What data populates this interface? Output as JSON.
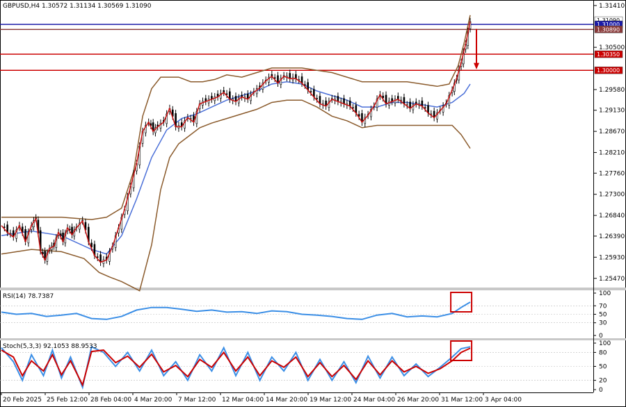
{
  "chart_data": [
    {
      "type": "candlestick",
      "title": "GBPUSD,H4  1.30572 1.31134 1.30569 1.31090",
      "ylim": [
        1.253,
        1.315
      ],
      "y_ticks": [
        "1.31410",
        "1.30500",
        "1.29580",
        "1.29130",
        "1.28670",
        "1.28210",
        "1.27760",
        "1.27300",
        "1.26840",
        "1.26390",
        "1.25930",
        "1.25470"
      ],
      "x_ticks": [
        "20 Feb 2025",
        "25 Feb 12:00",
        "28 Feb 04:00",
        "4 Mar 20:00",
        "7 Mar 12:00",
        "12 Mar 04:00",
        "14 Mar 20:00",
        "19 Mar 12:00",
        "24 Mar 04:00",
        "26 Mar 20:00",
        "31 Mar 12:00",
        "3 Apr 04:00"
      ],
      "price_labels": [
        {
          "text": "1.31090",
          "bg": "#ffffff",
          "fg": "#000000"
        },
        {
          "text": "1.31000",
          "bg": "#1a1aa8",
          "fg": "#ffffff"
        },
        {
          "text": "1.30890",
          "bg": "#8a3a3a",
          "fg": "#ffffff"
        },
        {
          "text": "1.30350",
          "bg": "#cc0000",
          "fg": "#ffffff"
        },
        {
          "text": "1.30000",
          "bg": "#cc0000",
          "fg": "#ffffff"
        }
      ],
      "levels": [
        {
          "value": 1.31,
          "color": "#1a1aa8"
        },
        {
          "value": 1.3089,
          "color": "#8a3a3a"
        },
        {
          "value": 1.3035,
          "color": "#cc0000"
        },
        {
          "value": 1.3,
          "color": "#cc0000"
        }
      ],
      "close_path": [
        [
          0,
          1.2665
        ],
        [
          4,
          1.265
        ],
        [
          8,
          1.264
        ],
        [
          12,
          1.2665
        ],
        [
          16,
          1.263
        ],
        [
          20,
          1.2665
        ],
        [
          23,
          1.268
        ],
        [
          26,
          1.261
        ],
        [
          29,
          1.259
        ],
        [
          32,
          1.2615
        ],
        [
          35,
          1.262
        ],
        [
          38,
          1.265
        ],
        [
          41,
          1.263
        ],
        [
          44,
          1.266
        ],
        [
          47,
          1.2645
        ],
        [
          50,
          1.266
        ],
        [
          54,
          1.2675
        ],
        [
          58,
          1.263
        ],
        [
          62,
          1.26
        ],
        [
          66,
          1.2585
        ],
        [
          70,
          1.259
        ],
        [
          74,
          1.262
        ],
        [
          78,
          1.266
        ],
        [
          82,
          1.27
        ],
        [
          86,
          1.275
        ],
        [
          90,
          1.28
        ],
        [
          94,
          1.287
        ],
        [
          98,
          1.289
        ],
        [
          101,
          1.287
        ],
        [
          104,
          1.288
        ],
        [
          108,
          1.289
        ],
        [
          112,
          1.292
        ],
        [
          116,
          1.288
        ],
        [
          120,
          1.288
        ],
        [
          124,
          1.29
        ],
        [
          128,
          1.289
        ],
        [
          132,
          1.293
        ],
        [
          136,
          1.2935
        ],
        [
          140,
          1.294
        ],
        [
          144,
          1.2945
        ],
        [
          148,
          1.2955
        ],
        [
          152,
          1.294
        ],
        [
          156,
          1.2935
        ],
        [
          160,
          1.2945
        ],
        [
          164,
          1.294
        ],
        [
          168,
          1.2955
        ],
        [
          172,
          1.2965
        ],
        [
          176,
          1.298
        ],
        [
          180,
          1.299
        ],
        [
          184,
          1.2975
        ],
        [
          188,
          1.299
        ],
        [
          192,
          1.2985
        ],
        [
          196,
          1.2985
        ],
        [
          200,
          1.2975
        ],
        [
          204,
          1.296
        ],
        [
          208,
          1.2945
        ],
        [
          212,
          1.293
        ],
        [
          216,
          1.2925
        ],
        [
          220,
          1.294
        ],
        [
          224,
          1.2935
        ],
        [
          228,
          1.293
        ],
        [
          232,
          1.2925
        ],
        [
          236,
          1.291
        ],
        [
          240,
          1.289
        ],
        [
          244,
          1.2905
        ],
        [
          248,
          1.2925
        ],
        [
          252,
          1.295
        ],
        [
          256,
          1.293
        ],
        [
          260,
          1.2935
        ],
        [
          264,
          1.294
        ],
        [
          268,
          1.293
        ],
        [
          272,
          1.292
        ],
        [
          276,
          1.293
        ],
        [
          280,
          1.2925
        ],
        [
          284,
          1.291
        ],
        [
          288,
          1.29
        ],
        [
          292,
          1.2915
        ],
        [
          296,
          1.293
        ],
        [
          300,
          1.296
        ],
        [
          303,
          1.2985
        ],
        [
          306,
          1.302
        ],
        [
          309,
          1.306
        ],
        [
          312,
          1.3109
        ]
      ],
      "mid_band": [
        [
          0,
          1.264
        ],
        [
          20,
          1.265
        ],
        [
          40,
          1.264
        ],
        [
          60,
          1.261
        ],
        [
          70,
          1.26
        ],
        [
          80,
          1.264
        ],
        [
          90,
          1.272
        ],
        [
          100,
          1.281
        ],
        [
          110,
          1.287
        ],
        [
          120,
          1.2895
        ],
        [
          130,
          1.2905
        ],
        [
          140,
          1.292
        ],
        [
          150,
          1.2935
        ],
        [
          160,
          1.2945
        ],
        [
          170,
          1.2955
        ],
        [
          180,
          1.297
        ],
        [
          190,
          1.2975
        ],
        [
          200,
          1.297
        ],
        [
          210,
          1.2955
        ],
        [
          220,
          1.2945
        ],
        [
          230,
          1.2935
        ],
        [
          240,
          1.292
        ],
        [
          250,
          1.292
        ],
        [
          260,
          1.293
        ],
        [
          270,
          1.293
        ],
        [
          280,
          1.2925
        ],
        [
          290,
          1.292
        ],
        [
          300,
          1.293
        ],
        [
          308,
          1.295
        ],
        [
          312,
          1.297
        ]
      ],
      "upper_band": [
        [
          0,
          1.268
        ],
        [
          20,
          1.268
        ],
        [
          40,
          1.268
        ],
        [
          60,
          1.2675
        ],
        [
          70,
          1.268
        ],
        [
          80,
          1.27
        ],
        [
          88,
          1.278
        ],
        [
          94,
          1.29
        ],
        [
          100,
          1.296
        ],
        [
          106,
          1.2985
        ],
        [
          112,
          1.2985
        ],
        [
          118,
          1.2985
        ],
        [
          126,
          1.2975
        ],
        [
          134,
          1.2975
        ],
        [
          142,
          1.298
        ],
        [
          150,
          1.299
        ],
        [
          160,
          1.2985
        ],
        [
          170,
          1.2995
        ],
        [
          180,
          1.3005
        ],
        [
          190,
          1.3005
        ],
        [
          200,
          1.3005
        ],
        [
          210,
          1.3
        ],
        [
          220,
          1.2995
        ],
        [
          230,
          1.2985
        ],
        [
          240,
          1.2975
        ],
        [
          250,
          1.2975
        ],
        [
          260,
          1.2975
        ],
        [
          270,
          1.2975
        ],
        [
          280,
          1.297
        ],
        [
          290,
          1.2965
        ],
        [
          298,
          1.297
        ],
        [
          304,
          1.301
        ],
        [
          308,
          1.306
        ],
        [
          312,
          1.312
        ]
      ],
      "lower_band": [
        [
          0,
          1.26
        ],
        [
          20,
          1.261
        ],
        [
          40,
          1.2605
        ],
        [
          55,
          1.259
        ],
        [
          65,
          1.256
        ],
        [
          72,
          1.255
        ],
        [
          80,
          1.254
        ],
        [
          92,
          1.252
        ],
        [
          100,
          1.262
        ],
        [
          106,
          1.274
        ],
        [
          112,
          1.281
        ],
        [
          118,
          1.284
        ],
        [
          124,
          1.2855
        ],
        [
          132,
          1.2875
        ],
        [
          140,
          1.2885
        ],
        [
          150,
          1.2895
        ],
        [
          160,
          1.2905
        ],
        [
          170,
          1.2915
        ],
        [
          180,
          1.293
        ],
        [
          190,
          1.2935
        ],
        [
          200,
          1.2935
        ],
        [
          210,
          1.292
        ],
        [
          220,
          1.29
        ],
        [
          230,
          1.289
        ],
        [
          240,
          1.2875
        ],
        [
          250,
          1.288
        ],
        [
          260,
          1.288
        ],
        [
          270,
          1.288
        ],
        [
          280,
          1.288
        ],
        [
          290,
          1.288
        ],
        [
          300,
          1.288
        ],
        [
          306,
          1.286
        ],
        [
          312,
          1.283
        ]
      ],
      "arrow_color": "#cc0000"
    },
    {
      "type": "line",
      "title": "RSI(14) 78.7387",
      "ylim": [
        0,
        100
      ],
      "y_ticks": [
        "100",
        "70",
        "50",
        "30",
        "0"
      ],
      "series": [
        {
          "color": "#3a8ee6",
          "values": [
            [
              0,
              55
            ],
            [
              10,
              50
            ],
            [
              20,
              52
            ],
            [
              30,
              45
            ],
            [
              40,
              48
            ],
            [
              50,
              52
            ],
            [
              60,
              40
            ],
            [
              70,
              38
            ],
            [
              80,
              45
            ],
            [
              90,
              60
            ],
            [
              100,
              66
            ],
            [
              110,
              66
            ],
            [
              120,
              62
            ],
            [
              130,
              57
            ],
            [
              140,
              60
            ],
            [
              150,
              55
            ],
            [
              160,
              56
            ],
            [
              170,
              52
            ],
            [
              180,
              58
            ],
            [
              190,
              56
            ],
            [
              200,
              50
            ],
            [
              210,
              48
            ],
            [
              220,
              45
            ],
            [
              230,
              40
            ],
            [
              240,
              38
            ],
            [
              250,
              48
            ],
            [
              260,
              52
            ],
            [
              270,
              44
            ],
            [
              280,
              46
            ],
            [
              290,
              44
            ],
            [
              300,
              52
            ],
            [
              306,
              66
            ],
            [
              312,
              78.7
            ]
          ]
        }
      ]
    },
    {
      "type": "line",
      "title": "Stoch(5,3,3) 92.1053 88.9533",
      "ylim": [
        0,
        100
      ],
      "y_ticks": [
        "100",
        "80",
        "50",
        "20",
        "0"
      ],
      "series": [
        {
          "color": "#3a8ee6",
          "values": [
            [
              0,
              90
            ],
            [
              8,
              60
            ],
            [
              14,
              20
            ],
            [
              20,
              75
            ],
            [
              28,
              30
            ],
            [
              34,
              85
            ],
            [
              40,
              25
            ],
            [
              46,
              70
            ],
            [
              54,
              5
            ],
            [
              60,
              92
            ],
            [
              68,
              80
            ],
            [
              76,
              50
            ],
            [
              84,
              80
            ],
            [
              92,
              40
            ],
            [
              100,
              85
            ],
            [
              108,
              30
            ],
            [
              116,
              60
            ],
            [
              124,
              20
            ],
            [
              132,
              75
            ],
            [
              140,
              40
            ],
            [
              148,
              90
            ],
            [
              156,
              30
            ],
            [
              164,
              80
            ],
            [
              172,
              20
            ],
            [
              180,
              70
            ],
            [
              188,
              40
            ],
            [
              196,
              80
            ],
            [
              204,
              20
            ],
            [
              212,
              65
            ],
            [
              220,
              20
            ],
            [
              228,
              60
            ],
            [
              236,
              15
            ],
            [
              244,
              72
            ],
            [
              252,
              25
            ],
            [
              260,
              70
            ],
            [
              268,
              30
            ],
            [
              276,
              55
            ],
            [
              284,
              28
            ],
            [
              292,
              48
            ],
            [
              300,
              70
            ],
            [
              306,
              88
            ],
            [
              312,
              92.1
            ]
          ]
        },
        {
          "color": "#cc0000",
          "values": [
            [
              0,
              85
            ],
            [
              8,
              70
            ],
            [
              14,
              30
            ],
            [
              20,
              62
            ],
            [
              28,
              40
            ],
            [
              34,
              75
            ],
            [
              40,
              32
            ],
            [
              46,
              62
            ],
            [
              54,
              10
            ],
            [
              60,
              82
            ],
            [
              68,
              85
            ],
            [
              76,
              58
            ],
            [
              84,
              72
            ],
            [
              92,
              48
            ],
            [
              100,
              76
            ],
            [
              108,
              38
            ],
            [
              116,
              52
            ],
            [
              124,
              28
            ],
            [
              132,
              65
            ],
            [
              140,
              48
            ],
            [
              148,
              80
            ],
            [
              156,
              40
            ],
            [
              164,
              70
            ],
            [
              172,
              30
            ],
            [
              180,
              62
            ],
            [
              188,
              48
            ],
            [
              196,
              70
            ],
            [
              204,
              28
            ],
            [
              212,
              58
            ],
            [
              220,
              28
            ],
            [
              228,
              52
            ],
            [
              236,
              22
            ],
            [
              244,
              62
            ],
            [
              252,
              32
            ],
            [
              260,
              62
            ],
            [
              268,
              38
            ],
            [
              276,
              50
            ],
            [
              284,
              35
            ],
            [
              292,
              45
            ],
            [
              300,
              62
            ],
            [
              306,
              80
            ],
            [
              312,
              89
            ]
          ]
        }
      ]
    }
  ]
}
